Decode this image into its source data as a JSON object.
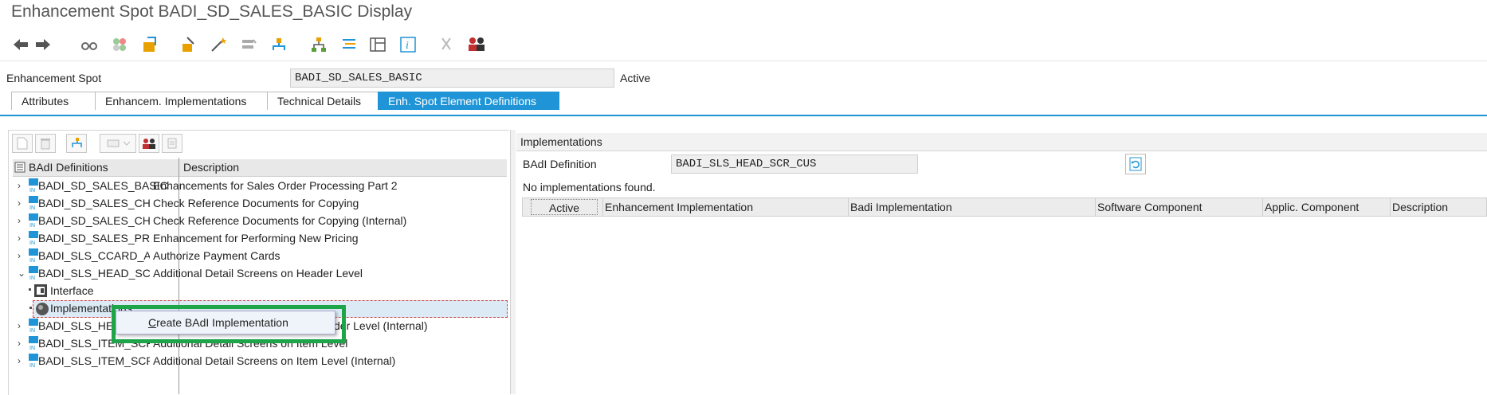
{
  "window": {
    "title": "Enhancement Spot BADI_SD_SALES_BASIC Display"
  },
  "toolbar": {
    "icons": [
      "back-arrow-icon",
      "forward-arrow-icon",
      "glasses-icon",
      "other-object-icon",
      "pencil-change-icon",
      "activate-icon",
      "check-icon",
      "wand-icon",
      "where-used-icon",
      "enhancement-icon",
      "hierarchy-icon",
      "list-icon",
      "layout-icon",
      "info-icon",
      "cut-icon",
      "persons-icon"
    ]
  },
  "header": {
    "spot_label": "Enhancement Spot",
    "spot_value": "BADI_SD_SALES_BASIC",
    "status": "Active"
  },
  "tabs": [
    {
      "label": "Attributes",
      "active": false
    },
    {
      "label": "Enhancem. Implementations",
      "active": false
    },
    {
      "label": "Technical Details",
      "active": false
    },
    {
      "label": "Enh. Spot Element Definitions",
      "active": true
    }
  ],
  "tree": {
    "col_definitions": "BAdI Definitions",
    "col_description": "Description",
    "rows": [
      {
        "name": "BADI_SD_SALES_BASIC",
        "desc": "Enhancements for Sales Order Processing Part 2",
        "expander": "›"
      },
      {
        "name": "BADI_SD_SALES_CHECK_",
        "desc": "Check Reference Documents for Copying",
        "expander": "›"
      },
      {
        "name": "BADI_SD_SALES_CHECK_",
        "desc": "Check Reference Documents for Copying (Internal)",
        "expander": "›"
      },
      {
        "name": "BADI_SD_SALES_PRICING",
        "desc": "Enhancement for Performing New Pricing",
        "expander": "›"
      },
      {
        "name": "BADI_SLS_CCARD_AUTH",
        "desc": "Authorize Payment Cards",
        "expander": "›"
      },
      {
        "name": "BADI_SLS_HEAD_SCR_CU",
        "desc": "Additional Detail Screens on Header Level",
        "expander": "⌄"
      },
      {
        "name": "Interface",
        "desc": "",
        "child": true
      },
      {
        "name": "Implementations",
        "desc": "",
        "child": true
      },
      {
        "name": "BADI_SLS_HEA",
        "desc": "der Level (Internal)",
        "expander": "›"
      },
      {
        "name": "BADI_SLS_ITEM_SCR_CU",
        "desc": "Additional Detail Screens on Item Level",
        "expander": "›"
      },
      {
        "name": "BADI_SLS_ITEM_SCR_IN",
        "desc": "Additional Detail Screens on Item Level (Internal)",
        "expander": "›"
      }
    ]
  },
  "context_menu": {
    "item": "Create BAdI Implementation"
  },
  "implementations": {
    "title": "Implementations",
    "badi_label": "BAdI Definition",
    "badi_value": "BADI_SLS_HEAD_SCR_CUS",
    "message": "No implementations found.",
    "columns": [
      "Active",
      "Enhancement Implementation",
      "Badi Implementation",
      "Software Component",
      "Applic. Component",
      "Description"
    ]
  },
  "colors": {
    "accent": "#1f94d6",
    "highlight": "#1ea54a"
  }
}
